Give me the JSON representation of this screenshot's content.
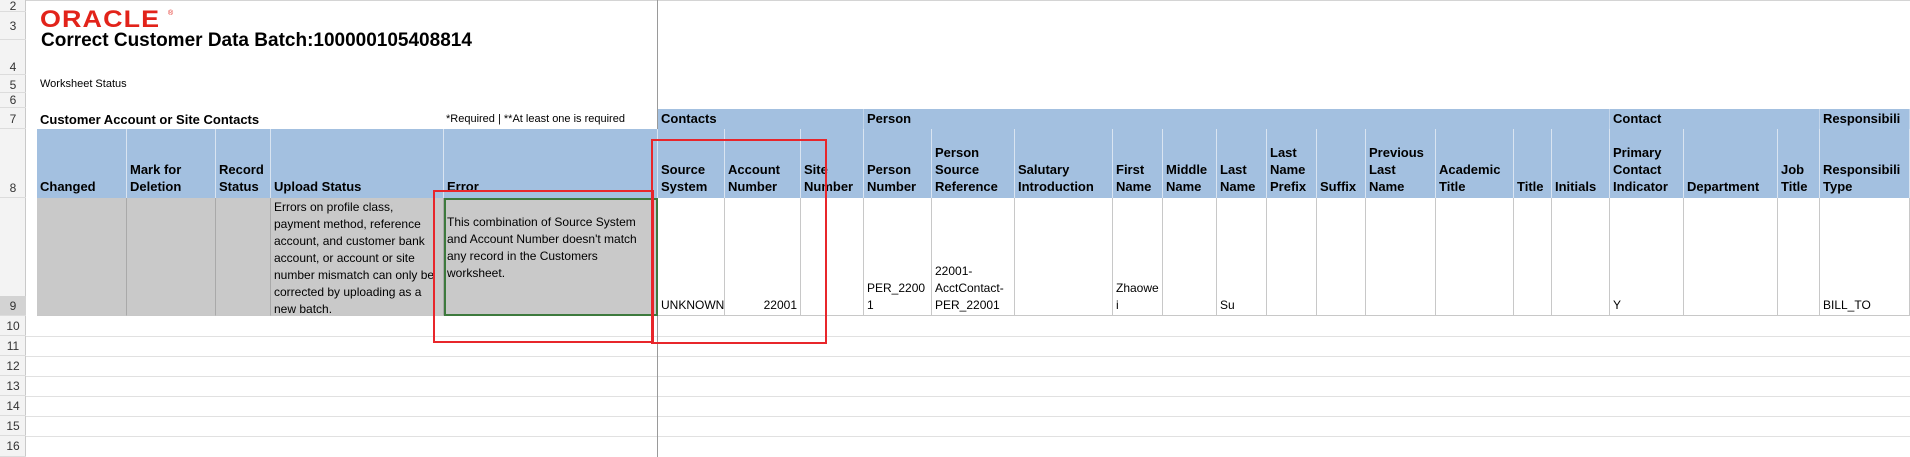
{
  "rows": [
    "2",
    "3",
    "4",
    "5",
    "6",
    "7",
    "8",
    "9",
    "10",
    "11",
    "12",
    "13",
    "14",
    "15",
    "16"
  ],
  "logo": {
    "text": "ORACLE",
    "tm": "®"
  },
  "title": "Correct Customer Data Batch:100000105408814",
  "worksheet_status_label": "Worksheet Status",
  "section_title": "Customer Account or Site Contacts",
  "required_note": "*Required | **At least one is required",
  "groups": {
    "contacts": "Contacts",
    "person": "Person",
    "contact": "Contact",
    "responsibility": "Responsibili"
  },
  "columns": {
    "changed": "Changed",
    "mark_for_deletion": "Mark for Deletion",
    "record_status": "Record Status",
    "upload_status": "Upload Status",
    "error": "Error",
    "source_system": "Source System",
    "account_number": "Account Number",
    "site_number": "Site Number",
    "person_number": "Person Number",
    "person_source_reference": "Person Source Reference",
    "salutary_introduction": "Salutary Introduction",
    "first_name": "First Name",
    "middle_name": "Middle Name",
    "last_name": "Last Name",
    "last_name_prefix": "Last Name Prefix",
    "suffix": "Suffix",
    "previous_last_name": "Previous Last Name",
    "academic_title": "Academic Title",
    "title": "Title",
    "initials": "Initials",
    "primary_contact_indicator": "Primary Contact Indicator",
    "department": "Department",
    "job_title": "Job Title",
    "responsibility_type": "Responsibili Type"
  },
  "record": {
    "changed": "",
    "mark_for_deletion": "",
    "record_status": "",
    "upload_status": "Errors on profile class, payment method, reference account, and customer bank account, or account or site number mismatch can only be corrected by uploading as a new batch.",
    "error": "This combination of Source System and Account Number doesn't match any record in the Customers worksheet.",
    "source_system": "UNKNOWN",
    "account_number": "22001",
    "site_number": "",
    "person_number": "PER_22001",
    "person_source_reference": "22001-AcctContact-PER_22001",
    "salutary_introduction": "",
    "first_name": "Zhaowei",
    "middle_name": "",
    "last_name": "Su",
    "last_name_prefix": "",
    "suffix": "",
    "previous_last_name": "",
    "academic_title": "",
    "title": "",
    "initials": "",
    "primary_contact_indicator": "Y",
    "department": "",
    "job_title": "",
    "responsibility_type": "BILL_TO"
  },
  "colors": {
    "header_blue": "#a3c0e0",
    "readonly_gray": "#c9c9c9",
    "oracle_red": "#e2231a",
    "highlight_red": "#e8262b"
  }
}
